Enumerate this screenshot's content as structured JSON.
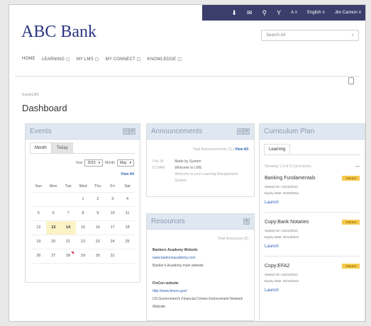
{
  "topbar": {
    "items": [
      {
        "icon": "download-icon",
        "glyph": "⬇"
      },
      {
        "icon": "chat-icon",
        "glyph": "✉"
      },
      {
        "icon": "people-icon",
        "glyph": "⚲"
      },
      {
        "icon": "signal-icon",
        "glyph": "Y"
      }
    ],
    "font_size_label": "A ≡",
    "language": "English ≡",
    "user": "Jim Cannon ≡"
  },
  "brand": {
    "logo": "ABC Bank",
    "color": "#2a3480"
  },
  "search": {
    "placeholder": "Search All",
    "icon": "search-icon"
  },
  "nav": {
    "items": [
      {
        "label": "HOME"
      },
      {
        "label": "LEARNING ▢"
      },
      {
        "label": "MY LMS ▢"
      },
      {
        "label": "MY CONNECT ▢"
      },
      {
        "label": "KNOWLEDGE ▢"
      }
    ]
  },
  "page": {
    "breadcrumb": "SyeskLMS",
    "title": "Dashboard"
  },
  "events": {
    "title": "Events",
    "tabs": [
      "Month",
      "Today"
    ],
    "year_label": "Year",
    "year_value": "2015",
    "month_label": "Month",
    "month_value": "May",
    "view_all": "View All",
    "weekdays": [
      "Sun",
      "Mon",
      "Tue",
      "Wed",
      "Thu",
      "Fri",
      "Sat"
    ],
    "weeks": [
      [
        "",
        "",
        "",
        "1",
        "2",
        "3",
        "4"
      ],
      [
        "5",
        "6",
        "7",
        "8",
        "9",
        "10",
        "11"
      ],
      [
        "12",
        "13",
        "14",
        "15",
        "16",
        "17",
        "18"
      ],
      [
        "19",
        "20",
        "21",
        "22",
        "23",
        "24",
        "25"
      ],
      [
        "26",
        "27",
        "28",
        "29",
        "30",
        "31",
        ""
      ]
    ]
  },
  "announcements": {
    "title": "Announcements",
    "total": "Total Announcements (1)",
    "view_all": "View All",
    "date": "Feb 14",
    "time": "8:19AM",
    "from": "Made by System",
    "line1": "Welcome to LMS",
    "line2": "Welcome to your Learning Management System"
  },
  "resources": {
    "title": "Resources",
    "total": "Total Resources (2)",
    "items": [
      {
        "name": "Bankers Academy Website",
        "url": "www.bankersacademy.com",
        "desc": "Banker's Academy main website"
      },
      {
        "name": "FinCen website",
        "url": "http://www.fincen.gov/",
        "desc": "US Government's Financial Crimes Enforcement Network Website"
      }
    ]
  },
  "curriculum": {
    "title": "Curriculum Plan",
    "tab": "Learning",
    "showing": "Showing 1-3 of 3 Curriculums",
    "pager": "◂ ▸",
    "items": [
      {
        "name": "Banking Fundamentals",
        "status": "Started",
        "started": "Started On: 01/16/2013",
        "expiry": "Expiry Date: 02/20/2014",
        "launch": "Launch"
      },
      {
        "name": "Copy:Bank Notaries",
        "status": "Started",
        "started": "Started On: 01/14/2013",
        "expiry": "Expiry Date: 01/14/2014",
        "launch": "Launch"
      },
      {
        "name": "Copy:EFA2",
        "status": "Started",
        "started": "Started On: 03/13/2013",
        "expiry": "Expiry Date: 04/14/2014",
        "launch": "Launch"
      }
    ]
  }
}
